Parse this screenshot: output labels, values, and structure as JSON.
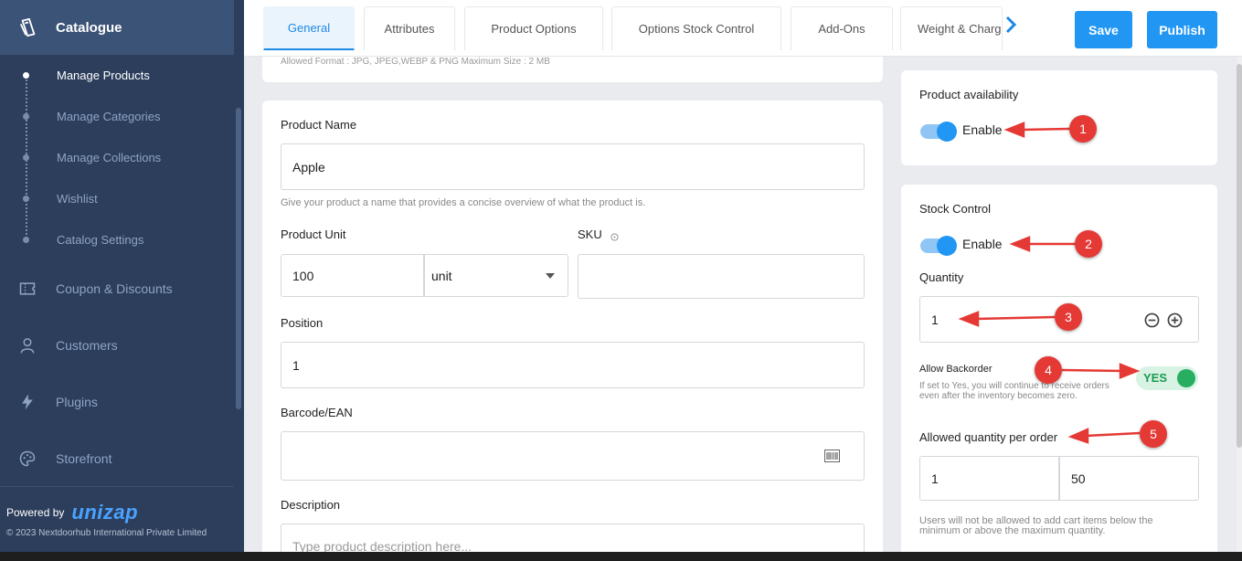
{
  "sidebar": {
    "title": "Catalogue",
    "sub_items": [
      {
        "label": "Manage Products"
      },
      {
        "label": "Manage Categories"
      },
      {
        "label": "Manage Collections"
      },
      {
        "label": "Wishlist"
      },
      {
        "label": "Catalog Settings"
      }
    ],
    "items": [
      {
        "label": "Coupon & Discounts",
        "icon": "coupon-icon"
      },
      {
        "label": "Customers",
        "icon": "user-icon"
      },
      {
        "label": "Plugins",
        "icon": "lightning-icon"
      },
      {
        "label": "Storefront",
        "icon": "palette-icon"
      }
    ],
    "powered_by": "Powered by",
    "brand": "unizap",
    "copyright": "© 2023 Nextdoorhub International Private Limited"
  },
  "tabs": [
    {
      "label": "General"
    },
    {
      "label": "Attributes"
    },
    {
      "label": "Product Options"
    },
    {
      "label": "Options Stock Control"
    },
    {
      "label": "Add-Ons"
    },
    {
      "label": "Weight & Charge"
    }
  ],
  "actions": {
    "save": "Save",
    "publish": "Publish"
  },
  "form": {
    "image_note": "Allowed Format : JPG, JPEG,WEBP & PNG Maximum Size : 2 MB",
    "product_name": {
      "label": "Product Name",
      "value": "Apple",
      "help": "Give your product a name that provides a concise overview of what the product is."
    },
    "product_unit": {
      "label": "Product Unit",
      "value": "100",
      "unit": "unit"
    },
    "sku": {
      "label": "SKU",
      "value": ""
    },
    "position": {
      "label": "Position",
      "value": "1"
    },
    "barcode": {
      "label": "Barcode/EAN",
      "value": ""
    },
    "description": {
      "label": "Description",
      "placeholder": "Type product description here..."
    }
  },
  "availability": {
    "label": "Product availability",
    "toggle_label": "Enable"
  },
  "stock": {
    "label": "Stock Control",
    "toggle_label": "Enable",
    "quantity_label": "Quantity",
    "quantity_value": "1",
    "backorder_label": "Allow Backorder",
    "backorder_help": "If set to Yes, you will continue to receive orders even after the inventory becomes zero.",
    "backorder_value": "YES",
    "per_order_label": "Allowed quantity per order",
    "per_order_min": "1",
    "per_order_max": "50",
    "per_order_help": "Users will not be allowed to add cart items below the minimum or above the maximum quantity."
  },
  "annotations": [
    "1",
    "2",
    "3",
    "4",
    "5"
  ],
  "colors": {
    "primary": "#2196f3",
    "sidebar": "#2c3e5c",
    "annotation": "#e53935",
    "success": "#27ae60"
  }
}
